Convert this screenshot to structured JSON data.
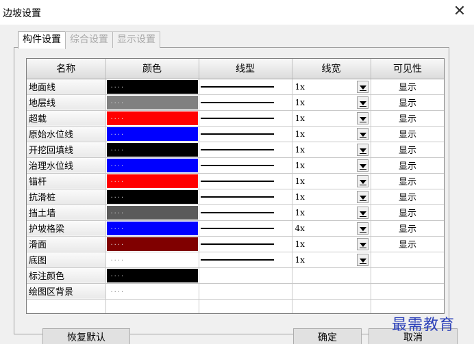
{
  "window": {
    "title": "边坡设置",
    "close_symbol": "✕"
  },
  "tabs": [
    {
      "label": "构件设置",
      "active": true
    },
    {
      "label": "综合设置",
      "active": false
    },
    {
      "label": "显示设置",
      "active": false
    }
  ],
  "columns": [
    "名称",
    "颜色",
    "线型",
    "线宽",
    "可见性"
  ],
  "rows": [
    {
      "name": "地面线",
      "color": "#000000",
      "width": "1x",
      "visible": "显示",
      "has_line": true
    },
    {
      "name": "地层线",
      "color": "#808080",
      "width": "1x",
      "visible": "显示",
      "has_line": true
    },
    {
      "name": "超载",
      "color": "#ff0000",
      "width": "1x",
      "visible": "显示",
      "has_line": true
    },
    {
      "name": "原始水位线",
      "color": "#0000ff",
      "width": "1x",
      "visible": "显示",
      "has_line": true
    },
    {
      "name": "开挖回填线",
      "color": "#000000",
      "width": "1x",
      "visible": "显示",
      "has_line": true
    },
    {
      "name": "治理水位线",
      "color": "#0000ff",
      "width": "1x",
      "visible": "显示",
      "has_line": true
    },
    {
      "name": "锚杆",
      "color": "#ff0000",
      "width": "1x",
      "visible": "显示",
      "has_line": true
    },
    {
      "name": "抗滑桩",
      "color": "#000000",
      "width": "1x",
      "visible": "显示",
      "has_line": true
    },
    {
      "name": "挡土墙",
      "color": "#5a5a5a",
      "width": "1x",
      "visible": "显示",
      "has_line": true
    },
    {
      "name": "护坡格梁",
      "color": "#0000ff",
      "width": "4x",
      "visible": "显示",
      "has_line": true
    },
    {
      "name": "滑面",
      "color": "#800000",
      "width": "1x",
      "visible": "显示",
      "has_line": true
    },
    {
      "name": "底图",
      "color": "#ffffff",
      "width": "1x",
      "visible": "",
      "has_line": true
    },
    {
      "name": "标注颜色",
      "color": "#000000",
      "width": "",
      "visible": "",
      "has_line": false
    },
    {
      "name": "绘图区背景",
      "color": "#ffffff",
      "width": "",
      "visible": "",
      "has_line": false
    }
  ],
  "swatch_dots": "....",
  "buttons": {
    "reset": "恢复默认",
    "ok": "确定",
    "cancel": "取消"
  },
  "watermark": "最需教育"
}
